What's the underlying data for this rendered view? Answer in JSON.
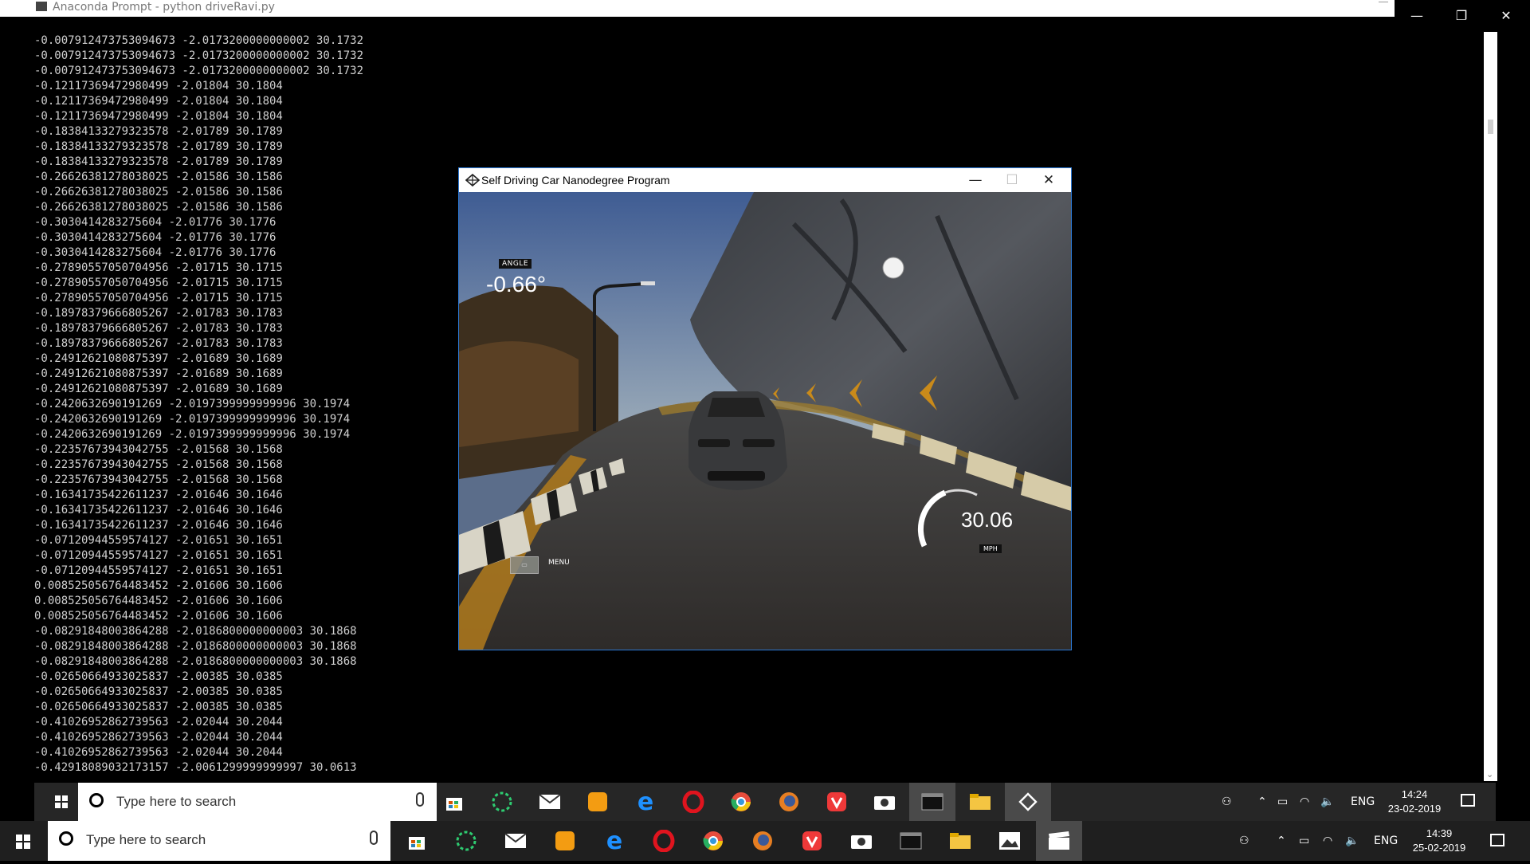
{
  "console": {
    "title": "Anaconda Prompt - python  driveRavi.py",
    "lines": [
      "-0.007912473753094673 -2.0173200000000002 30.1732",
      "-0.007912473753094673 -2.0173200000000002 30.1732",
      "-0.007912473753094673 -2.0173200000000002 30.1732",
      "-0.12117369472980499 -2.01804 30.1804",
      "-0.12117369472980499 -2.01804 30.1804",
      "-0.12117369472980499 -2.01804 30.1804",
      "-0.18384133279323578 -2.01789 30.1789",
      "-0.18384133279323578 -2.01789 30.1789",
      "-0.18384133279323578 -2.01789 30.1789",
      "-0.26626381278038025 -2.01586 30.1586",
      "-0.26626381278038025 -2.01586 30.1586",
      "-0.26626381278038025 -2.01586 30.1586",
      "-0.3030414283275604 -2.01776 30.1776",
      "-0.3030414283275604 -2.01776 30.1776",
      "-0.3030414283275604 -2.01776 30.1776",
      "-0.27890557050704956 -2.01715 30.1715",
      "-0.27890557050704956 -2.01715 30.1715",
      "-0.27890557050704956 -2.01715 30.1715",
      "-0.18978379666805267 -2.01783 30.1783",
      "-0.18978379666805267 -2.01783 30.1783",
      "-0.18978379666805267 -2.01783 30.1783",
      "-0.2491262108087539​7 -2.01689 30.1689",
      "-0.24912621080875397 -2.01689 30.1689",
      "-0.24912621080875397 -2.01689 30.1689",
      "-0.2420632690191269 -2.0197399999999996 30.1974",
      "-0.2420632690191269 -2.0197399999999996 30.1974",
      "-0.2420632690191269 -2.0197399999999996 30.1974",
      "-0.22357673943042755 -2.01568 30.1568",
      "-0.22357673943042755 -2.01568 30.1568",
      "-0.22357673943042755 -2.01568 30.1568",
      "-0.16341735422611237 -2.01646 30.1646",
      "-0.16341735422611237 -2.01646 30.1646",
      "-0.16341735422611237 -2.01646 30.1646",
      "-0.07120944559574127 -2.01651 30.1651",
      "-0.07120944559574127 -2.01651 30.1651",
      "-0.07120944559574127 -2.01651 30.1651",
      "0.008525056764483452 -2.01606 30.1606",
      "0.008525056764483452 -2.01606 30.1606",
      "0.008525056764483452 -2.01606 30.1606",
      "-0.08291848003864288 -2.0186800000000003 30.1868",
      "-0.08291848003864288 -2.0186800000000003 30.1868",
      "-0.08291848003864288 -2.0186800000000003 30.1868",
      "-0.02650664933025837 -2.00385 30.0385",
      "-0.02650664933025837 -2.00385 30.0385",
      "-0.02650664933025837 -2.00385 30.0385",
      "-0.41026952862739563 -2.02044 30.2044",
      "-0.41026952862739563 -2.02044 30.2044",
      "-0.41026952862739563 -2.02044 30.2044",
      "-0.42918089032173157 -2.0061299999999997 30.0613"
    ]
  },
  "simulator": {
    "title": "Self Driving Car Nanodegree Program",
    "hud": {
      "angle_label": "ANGLE",
      "angle_value": "-0.66°",
      "speed_value": "30.06",
      "speed_unit": "MPH",
      "menu_label": "MENU"
    }
  },
  "taskbar_top": {
    "search_placeholder": "Type here to search",
    "language": "ENG",
    "time": "14:24",
    "date": "23-02-2019"
  },
  "taskbar_bottom": {
    "search_placeholder": "Type here to search",
    "language": "ENG",
    "time": "14:39",
    "date": "25-02-2019"
  },
  "colors": {
    "accent_blue": "#2b79d6",
    "console_bg": "#000000",
    "taskbar_bg": "#262626"
  }
}
